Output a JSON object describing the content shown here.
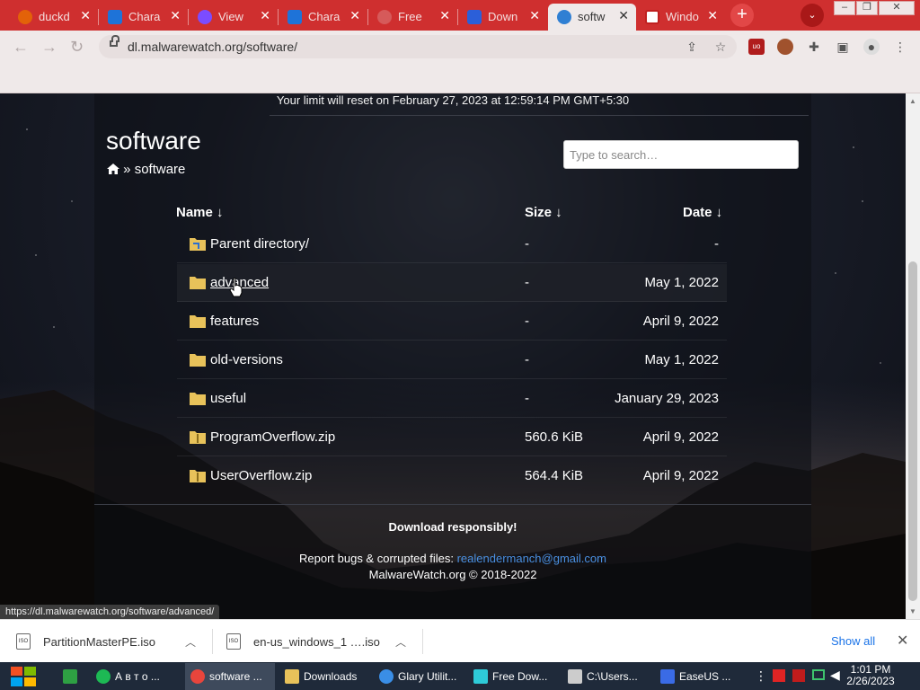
{
  "browser": {
    "tabs": [
      {
        "label": "duckd",
        "color": "#e36209"
      },
      {
        "label": "Chara",
        "color": "#1e73d8"
      },
      {
        "label": "View",
        "color": "#7b4cff"
      },
      {
        "label": "Chara",
        "color": "#1e73d8"
      },
      {
        "label": "Free",
        "color": "#d65a5a"
      },
      {
        "label": "Down",
        "color": "#2b5fd9"
      },
      {
        "label": "softw",
        "color": "#2f7fd3",
        "active": true
      },
      {
        "label": "Windo",
        "color": "#ffffff"
      }
    ],
    "close_glyph": "✕",
    "new_tab_glyph": "+",
    "tab_search_glyph": "⌄",
    "url": "dl.malwarewatch.org/software/",
    "status_url": "https://dl.malwarewatch.org/software/advanced/"
  },
  "page": {
    "limit_text": "Your limit will reset on February 27, 2023 at 12:59:14 PM GMT+5:30",
    "title": "software",
    "breadcrumb_sep": " » ",
    "breadcrumb_current": "software",
    "search_placeholder": "Type to search…",
    "columns": {
      "name": "Name ↓",
      "size": "Size ↓",
      "date": "Date ↓"
    },
    "rows": [
      {
        "name": "Parent directory/",
        "size": "-",
        "date": "-"
      },
      {
        "name": "advanced",
        "size": "-",
        "date": "May 1, 2022",
        "hover": true
      },
      {
        "name": "features",
        "size": "-",
        "date": "April 9, 2022"
      },
      {
        "name": "old-versions",
        "size": "-",
        "date": "May 1, 2022"
      },
      {
        "name": "useful",
        "size": "-",
        "date": "January 29, 2023"
      },
      {
        "name": "ProgramOverflow.zip",
        "size": "560.6 KiB",
        "date": "April 9, 2022"
      },
      {
        "name": "UserOverflow.zip",
        "size": "564.4 KiB",
        "date": "April 9, 2022"
      }
    ],
    "download_responsibly": "Download responsibly!",
    "bugs_label": "Report bugs & corrupted files: ",
    "bugs_email": "realendermanch@gmail.com",
    "copyright": "MalwareWatch.org © 2018-2022"
  },
  "downloads": {
    "items": [
      {
        "name": "PartitionMasterPE.iso"
      },
      {
        "name": "en-us_windows_1 ….iso"
      }
    ],
    "show_all": "Show all"
  },
  "taskbar": {
    "apps": [
      {
        "label": "",
        "color": "#2ea043"
      },
      {
        "label": "А в т о ...",
        "color": "#1db954"
      },
      {
        "label": "software ...",
        "color": "#e8453c",
        "active": true
      },
      {
        "label": "Downloads",
        "color": "#e8c25a"
      },
      {
        "label": "Glary Utilit...",
        "color": "#3a8ee6"
      },
      {
        "label": "Free Dow...",
        "color": "#2ecbd8"
      },
      {
        "label": "C:\\Users...",
        "color": "#cccccc"
      },
      {
        "label": "EaseUS ...",
        "color": "#3a6be6"
      }
    ],
    "time": "1:01 PM",
    "date": "2/26/2023"
  }
}
